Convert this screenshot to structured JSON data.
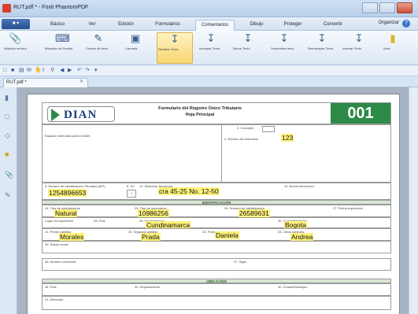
{
  "window": {
    "title": "RUT.pdf * - Foxit PhantomPDF"
  },
  "menu": {
    "file": "",
    "tabs": [
      "Básico",
      "Ver",
      "Edición",
      "Formularios",
      "Comentarios",
      "Dibujo",
      "Proteger",
      "Convertir"
    ],
    "right": "Organizar"
  },
  "ribbon": {
    "buttons": [
      "Adjuntar archivo",
      "Máquina de Escribir",
      "Cuadro de texto",
      "Llamada",
      "Resaltar Texto",
      "subrayar Texto",
      "Tachar Texto",
      "Serpentear texto",
      "Reemplazar Texto",
      "Insertar Texto",
      "Nota"
    ]
  },
  "document_tab": "RUT.pdf *",
  "form": {
    "title": "Formulario del Registro Único Tributario",
    "subtitle": "Hoja Principal",
    "logo": "DIAN",
    "watermark_logo": "",
    "code": "001",
    "concepto_label": "2. Concepto",
    "reserved_label": "Espacio reservado para la DIAN",
    "form_number_label": "4. Número de formulario",
    "form_number": "123",
    "nit_label": "5. Número de Identificación Tributaria (NIT)",
    "nit": "1254896653",
    "dv_label": "6. DV",
    "dv": "-",
    "direccion_label": "12. Dirección Seccional",
    "direccion": "cra 45-25 No. 12-50",
    "buzon_label": "14. Buzón electrónico",
    "section_identificacion": "IDENTIFICACIÓN",
    "tipo_contribuyente_label": "24. Tipo de contribuyente",
    "tipo_contribuyente": "Natural",
    "tipo_documento_label": "25. Tipo de documento",
    "tipo_documento": "10986256",
    "num_identificacion_label": "26. Número de Identificación",
    "num_identificacion": "26589631",
    "fecha_expedicion_label": "27. Fecha expedición",
    "lugar_label": "Lugar de expedición",
    "pais_label": "28. País",
    "departamento_label": "29. Departamento",
    "departamento": "Cundinamarca",
    "ciudad_label": "30. Ciudad/Municipio",
    "ciudad": "Bogota",
    "primer_apellido_label": "31. Primer apellido",
    "primer_apellido": "Morales",
    "segundo_apellido_label": "32. Segundo apellido",
    "segundo_apellido": "Prada",
    "primer_nombre_label": "33. Primer nombre",
    "primer_nombre": "Daniela",
    "otros_nombres_label": "34. Otros nombres",
    "otros_nombres": "Andrea",
    "razon_social_label": "35. Razón social",
    "nombre_comercial_label": "36. Nombre comercial",
    "sigla_label": "37. Sigla",
    "section_ubicacion": "UBICACIÓN",
    "u_pais_label": "38. País",
    "u_departamento_label": "39. Departamento",
    "u_ciudad_label": "40. Ciudad/Municipio",
    "u_direccion_label": "41. Dirección"
  },
  "colors": {
    "highlight": "#fff27a",
    "code_bg": "#2d8a47",
    "section_band": "#d9e7d2",
    "dian_blue": "#1e3b7a"
  }
}
